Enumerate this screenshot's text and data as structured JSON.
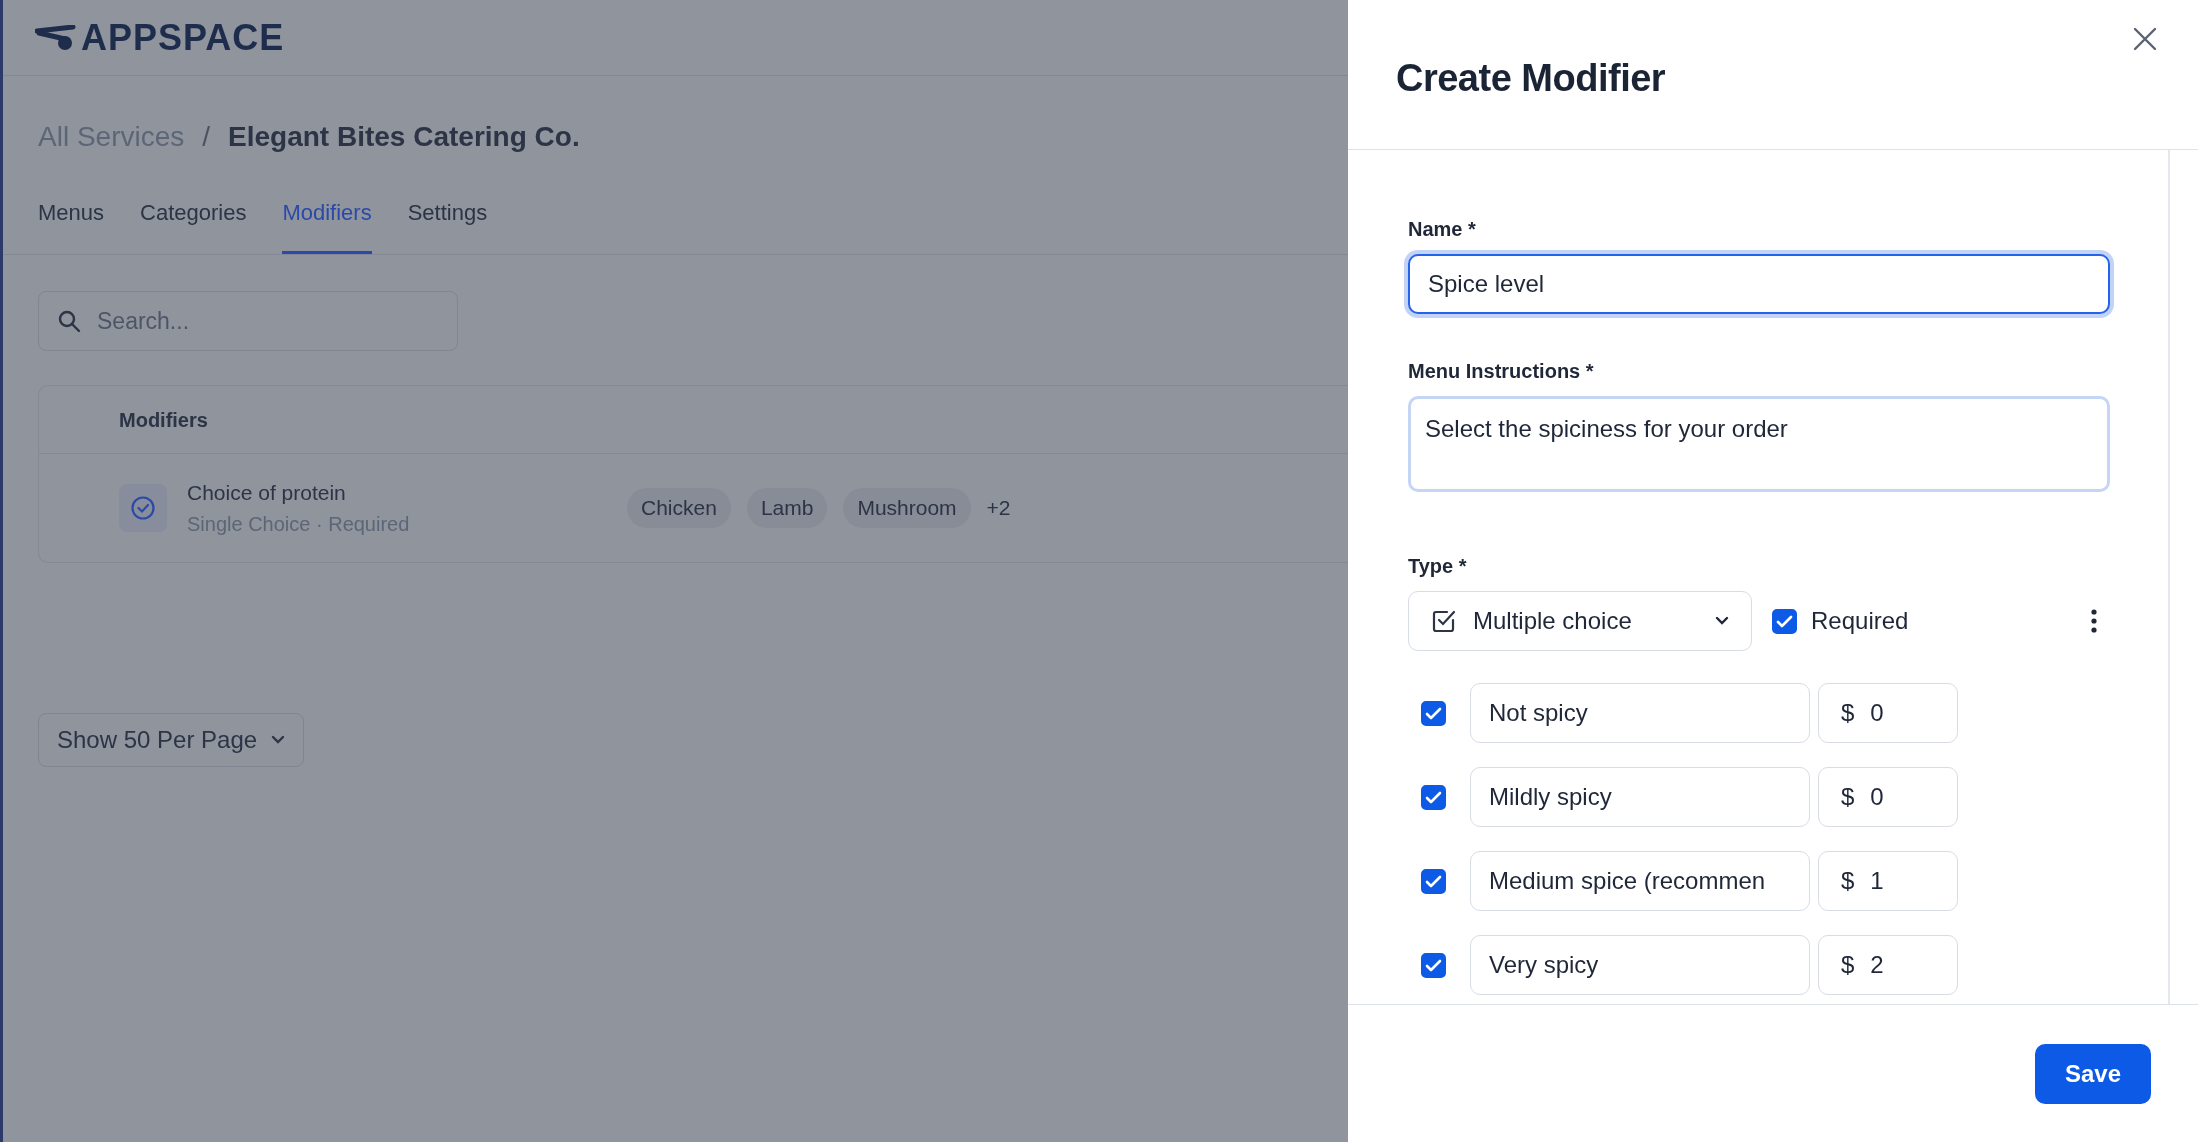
{
  "app": {
    "logo": "APPSPACE"
  },
  "breadcrumb_separator": "/",
  "breadcrumb": [
    {
      "label": "All Services",
      "current": false
    },
    {
      "label": "Elegant Bites Catering Co.",
      "current": true
    }
  ],
  "tabs": [
    {
      "label": "Menus",
      "selected": false
    },
    {
      "label": "Categories",
      "selected": false
    },
    {
      "label": "Modifiers",
      "selected": true
    },
    {
      "label": "Settings",
      "selected": false
    }
  ],
  "search": {
    "placeholder": "Search..."
  },
  "table": {
    "columns": [
      "Modifiers"
    ],
    "rows": [
      {
        "name": "Choice of protein",
        "subtitle": "Single Choice · Required",
        "tags": [
          "Chicken",
          "Lamb",
          "Mushroom"
        ],
        "more": "+2"
      }
    ]
  },
  "pagination": {
    "label": "Show 50 Per Page"
  },
  "panel": {
    "title": "Create Modifier",
    "name": {
      "label": "Name *",
      "value": "Spice level",
      "focused": true
    },
    "instructions": {
      "label": "Menu Instructions *",
      "value": "Select the spiciness for your order"
    },
    "type": {
      "label": "Type *",
      "value": "Multiple choice"
    },
    "required": {
      "label": "Required",
      "checked": true
    },
    "options": [
      {
        "checked": true,
        "label": "Not spicy",
        "currency": "$",
        "price": "0"
      },
      {
        "checked": true,
        "label": "Mildly spicy",
        "currency": "$",
        "price": "0"
      },
      {
        "checked": true,
        "label": "Medium spice (recommen",
        "currency": "$",
        "price": "1"
      },
      {
        "checked": true,
        "label": "Very spicy",
        "currency": "$",
        "price": "2"
      }
    ],
    "save": "Save"
  }
}
